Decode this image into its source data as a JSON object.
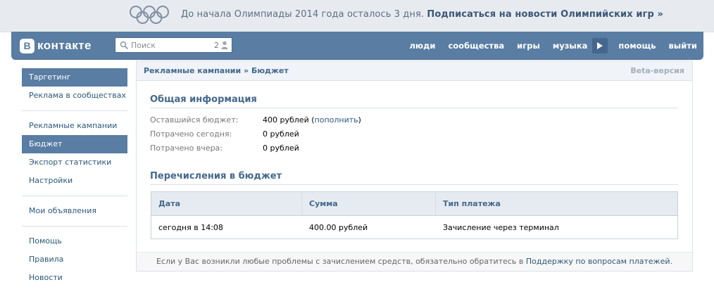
{
  "banner": {
    "text": "До начала Олимпиады 2014 года осталось 3 дня.",
    "link": "Подписаться на новости Олимпийских игр »"
  },
  "header": {
    "logo_letter": "В",
    "logo_text": "контакте",
    "search_placeholder": "Поиск",
    "search_count": "2",
    "nav": [
      "люди",
      "сообщества",
      "игры",
      "музыка",
      "помощь",
      "выйти"
    ]
  },
  "sidebar": {
    "groups": [
      [
        {
          "label": "Таргетинг",
          "active": true
        },
        {
          "label": "Реклама в сообществах",
          "active": false
        }
      ],
      [
        {
          "label": "Рекламные кампании",
          "active": false
        },
        {
          "label": "Бюджет",
          "active": true
        },
        {
          "label": "Экспорт статистики",
          "active": false
        },
        {
          "label": "Настройки",
          "active": false
        }
      ],
      [
        {
          "label": "Мои объявления",
          "active": false
        }
      ],
      [
        {
          "label": "Помощь",
          "active": false
        },
        {
          "label": "Правила",
          "active": false
        },
        {
          "label": "Новости",
          "active": false
        }
      ]
    ]
  },
  "panel": {
    "breadcrumb": "Рекламные кампании » Бюджет",
    "beta": "Beta-версия",
    "general_title": "Общая информация",
    "info": {
      "remaining_label": "Оставшийся бюджет:",
      "remaining_value": "400 рублей (",
      "remaining_link": "пополнить",
      "remaining_close": ")",
      "today_label": "Потрачено сегодня:",
      "today_value": "0 рублей",
      "yesterday_label": "Потрачено вчера:",
      "yesterday_value": "0 рублей"
    },
    "transfers_title": "Перечисления в бюджет",
    "table": {
      "columns": [
        "Дата",
        "Сумма",
        "Тип платежа"
      ],
      "rows": [
        [
          "сегодня в 14:08",
          "400.00 рублей",
          "Зачисление через терминал"
        ]
      ]
    },
    "footer_text": "Если у Вас возникли любые проблемы с зачислением средств, обязательно обратитесь в ",
    "footer_link": "Поддержку по вопросам платежей",
    "footer_end": "."
  },
  "colors": {
    "brand": "#597da3",
    "link": "#2b587a",
    "heading": "#45688e"
  }
}
